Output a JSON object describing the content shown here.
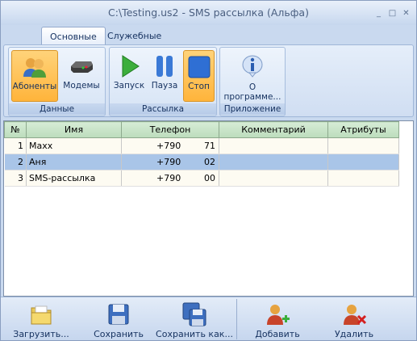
{
  "window": {
    "title": "C:\\Testing.us2 - SMS рассылка (Альфа)",
    "minimize": "_",
    "maximize": "□",
    "close": "✕"
  },
  "tabs": [
    {
      "label": "Основные",
      "active": true
    },
    {
      "label": "Служебные",
      "active": false
    }
  ],
  "ribbon": {
    "groups": [
      {
        "label": "Данные",
        "buttons": [
          {
            "label": "Абоненты",
            "icon": "users-icon",
            "selected": true
          },
          {
            "label": "Модемы",
            "icon": "modem-icon",
            "selected": false
          }
        ]
      },
      {
        "label": "Рассылка",
        "buttons": [
          {
            "label": "Запуск",
            "icon": "play-icon",
            "selected": false
          },
          {
            "label": "Пауза",
            "icon": "pause-icon",
            "selected": false
          },
          {
            "label": "Стоп",
            "icon": "stop-icon",
            "selected": true
          }
        ]
      },
      {
        "label": "Приложение",
        "buttons": [
          {
            "label": "О программе...",
            "icon": "info-icon",
            "selected": false
          }
        ]
      }
    ]
  },
  "grid": {
    "columns": [
      "№",
      "Имя",
      "Телефон",
      "Комментарий",
      "Атрибуты"
    ],
    "rows": [
      {
        "num": "1",
        "name": "Maxx",
        "phone_prefix": "+790",
        "phone_suffix": "71",
        "comment": "",
        "attrs": "",
        "selected": false
      },
      {
        "num": "2",
        "name": "Аня",
        "phone_prefix": "+790",
        "phone_suffix": "02",
        "comment": "",
        "attrs": "",
        "selected": true
      },
      {
        "num": "3",
        "name": "SMS-рассылка",
        "phone_prefix": "+790",
        "phone_suffix": "00",
        "comment": "",
        "attrs": "",
        "selected": false
      }
    ]
  },
  "bottom": {
    "load": "Загрузить...",
    "save": "Сохранить",
    "save_as": "Сохранить как...",
    "add": "Добавить",
    "delete": "Удалить"
  },
  "colors": {
    "accent": "#ffb43b",
    "selection": "#a9c5e8",
    "header": "#c9d9ef"
  }
}
